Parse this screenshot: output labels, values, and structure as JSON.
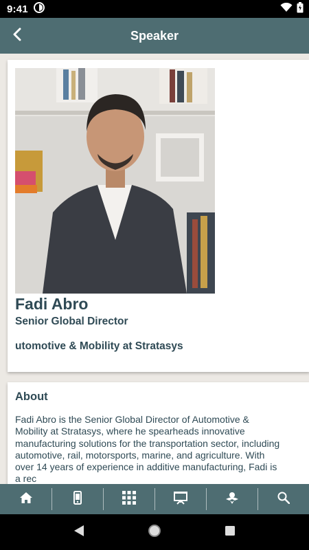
{
  "status_bar": {
    "time": "9:41"
  },
  "app_bar": {
    "title": "Speaker"
  },
  "speaker": {
    "name": "Fadi Abro",
    "role": "Senior Global Director",
    "company": "utomotive & Mobility at Stratasys"
  },
  "about": {
    "heading": "About",
    "text": "Fadi Abro is the Senior Global Director of Automotive & Mobility at Stratasys, where he spearheads innovative manufacturing solutions for the transportation sector, including automotive, rail, motorsports, marine, and agriculture. With over 14 years of experience in additive manufacturing, Fadi is a rec"
  },
  "bottom_nav": {
    "items": [
      "home-icon",
      "phone-icon",
      "grid-icon",
      "presentation-icon",
      "sponsor-icon",
      "search-icon"
    ]
  },
  "colors": {
    "bar": "#4e6d72",
    "text": "#2f4a55",
    "background": "#ece9e4"
  }
}
